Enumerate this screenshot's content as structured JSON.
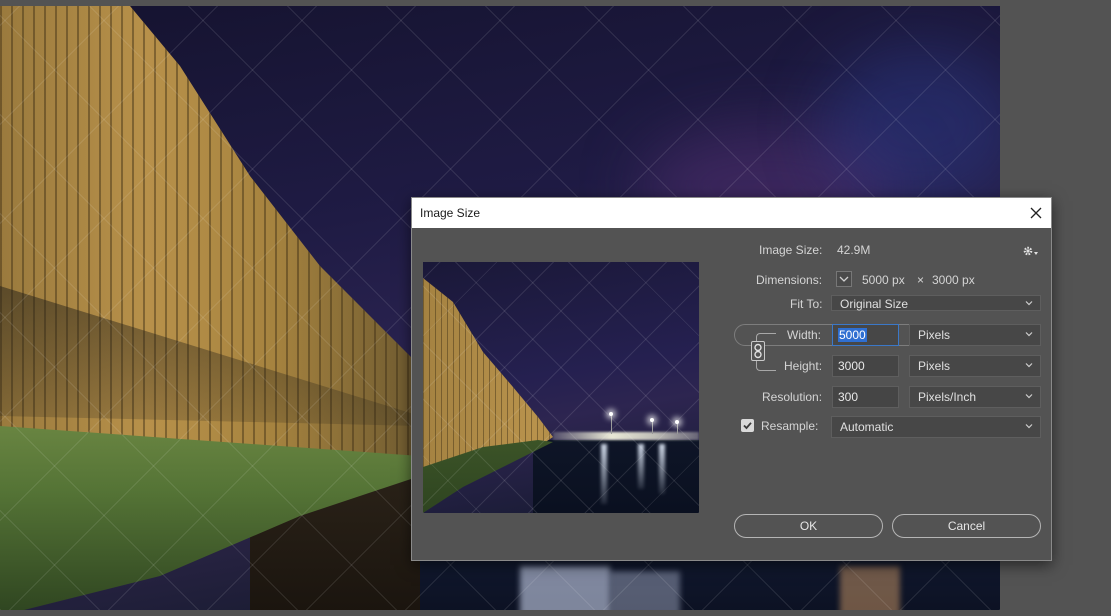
{
  "dialog": {
    "title": "Image Size",
    "image_size_label": "Image Size:",
    "image_size_value": "42.9M",
    "dimensions_label": "Dimensions:",
    "dim_width": "5000 px",
    "dim_sep": "×",
    "dim_height": "3000 px",
    "fit_to_label": "Fit To:",
    "fit_to_value": "Original Size",
    "width_label": "Width:",
    "width_value": "5000",
    "width_unit": "Pixels",
    "height_label": "Height:",
    "height_value": "3000",
    "height_unit": "Pixels",
    "resolution_label": "Resolution:",
    "resolution_value": "300",
    "resolution_unit": "Pixels/Inch",
    "resample_label": "Resample:",
    "resample_checked": true,
    "resample_value": "Automatic",
    "ok_label": "OK",
    "cancel_label": "Cancel"
  },
  "icons": {
    "close": "close-icon",
    "settings": "gear-icon",
    "dimensions_toggle": "chevron-down-icon",
    "constrain": "link-icon",
    "resample_checkbox": "checkmark-icon"
  },
  "colors": {
    "dialog_bg": "#535353",
    "field_bg": "#454545",
    "focus_border": "#3b78c8",
    "selection": "#2f6fd1"
  }
}
